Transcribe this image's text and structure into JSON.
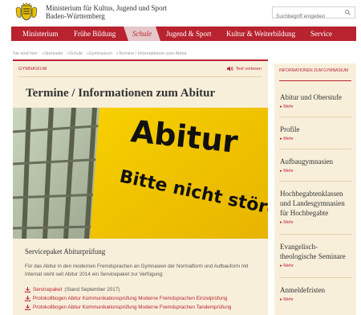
{
  "header": {
    "ministry_line1": "Ministerium für Kultus, Jugend und Sport",
    "ministry_line2": "Baden-Württemberg",
    "search_placeholder": "Suchbegriff eingeben",
    "logo_icon": "state-crest",
    "search_icon": "magnifier-icon"
  },
  "nav": {
    "items": [
      {
        "label": "Ministerium"
      },
      {
        "label": "Frühe Bildung"
      },
      {
        "label": "Schule"
      },
      {
        "label": "Jugend & Sport"
      },
      {
        "label": "Kultur & Weiterbildung"
      },
      {
        "label": "Service"
      }
    ],
    "active": "Schule"
  },
  "breadcrumb": {
    "prefix": "Sie sind hier:",
    "items": [
      "»Startseite",
      "»Schule",
      "»Gymnasium",
      "»Termine / Informationen zum Abitur"
    ]
  },
  "main": {
    "section_label": "GYMNASIUM",
    "read_aloud": "Text vorlesen",
    "title": "Termine / Informationen zum Abitur",
    "hero": {
      "sign_line1": "Abitur",
      "sign_line2": "Bitte nicht stören"
    },
    "subtitle": "Servicepaket Abiturprüfung",
    "paragraph": "Für das Abitur in den modernen Fremdsprachen an Gymnasien der Normalform und Aufbauform mit Internat steht seit Abitur 2014 ein Servicepaket zur Verfügung:",
    "downloads": [
      {
        "link": "Servicepaket",
        "note": "(Stand September 2017)"
      },
      {
        "link": "Protokollbogen Abitur Kommunikationsprüfung Moderne Fremdsprachen Einzelprüfung",
        "note": ""
      },
      {
        "link": "Protokollbogen Abitur Kommunikationsprüfung Moderne Fremdsprachen Tandemprüfung",
        "note": ""
      }
    ]
  },
  "sidebar": {
    "heading": "INFORMATIONEN ZUM GYMNASIUM",
    "items": [
      {
        "title": "Abitur und Oberstufe",
        "more": "▸ Mehr"
      },
      {
        "title": "Profile",
        "more": "▸ Mehr"
      },
      {
        "title": "Aufbaugymnasien",
        "more": "▸ Mehr"
      },
      {
        "title": "Hochbegabtenklassen und Landesgymnasien für Hochbegabte",
        "more": "▸ Mehr"
      },
      {
        "title": "Evangelisch-theologische Seminare",
        "more": "▸ Mehr"
      },
      {
        "title": "Anmeldefristen",
        "more": "▸ Mehr"
      }
    ]
  },
  "colors": {
    "brand_red": "#b8232f",
    "panel_beige": "#f8efdb",
    "active_tab": "#e6c7c9",
    "sign_yellow": "#f2c300"
  }
}
